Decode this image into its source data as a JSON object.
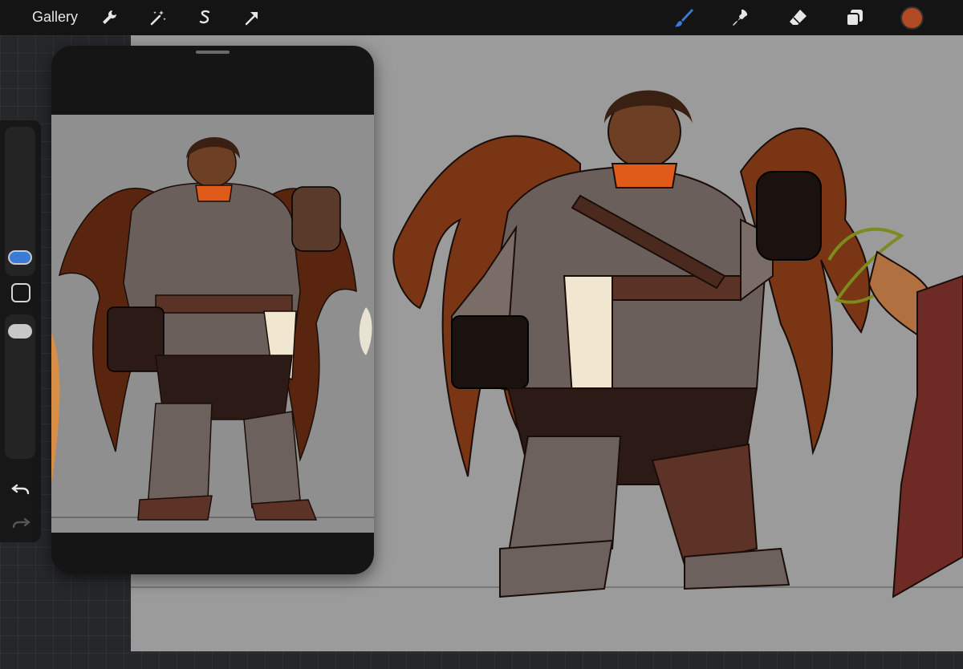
{
  "topbar": {
    "gallery_label": "Gallery",
    "tools_left": [
      "wrench-icon",
      "magic-wand-icon",
      "selection-s-icon",
      "transform-arrow-icon"
    ],
    "tools_right": [
      "brush-icon",
      "smudge-icon",
      "eraser-icon",
      "layers-icon"
    ],
    "brush_active_color": "#3a7bd5"
  },
  "current_color": "#b04a22",
  "canvas": {
    "background": "#9b9b9b"
  },
  "reference_window": {
    "image_background": "#8f8f8f"
  }
}
